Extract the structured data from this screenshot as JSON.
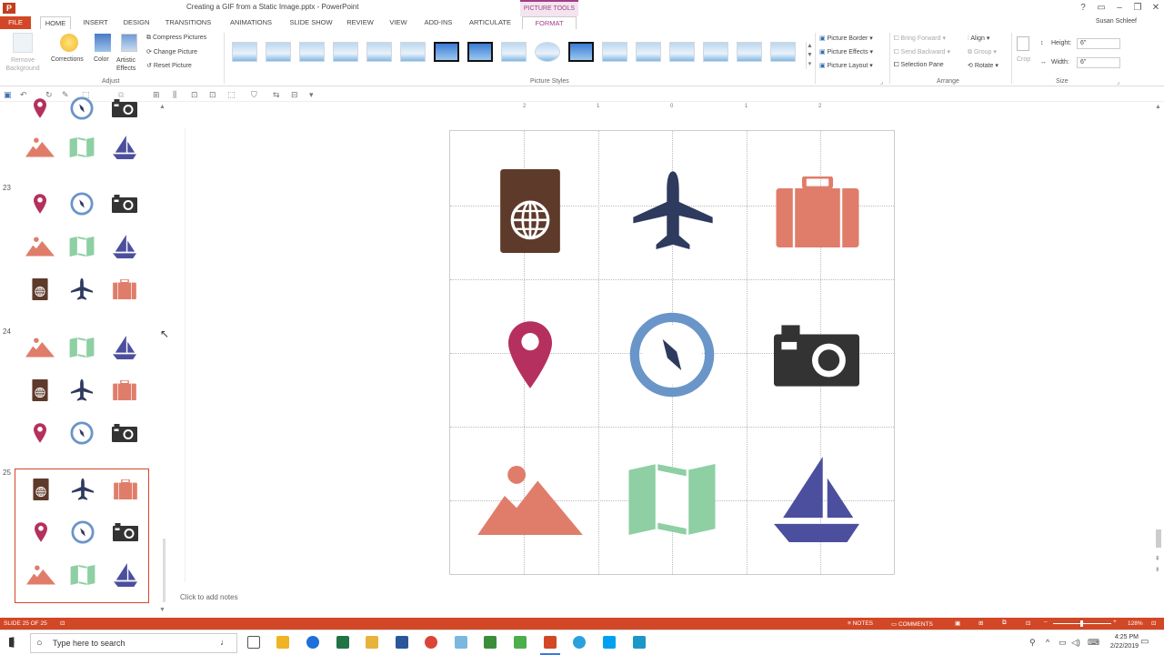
{
  "window": {
    "title": "Creating a GIF from a Static Image.pptx - PowerPoint",
    "contextual_tab_group": "PICTURE TOOLS",
    "user": "Susan Schleef",
    "app_icon_letter": "P"
  },
  "tabs": [
    "FILE",
    "HOME",
    "INSERT",
    "DESIGN",
    "TRANSITIONS",
    "ANIMATIONS",
    "SLIDE SHOW",
    "REVIEW",
    "VIEW",
    "ADD-INS",
    "ARTICULATE",
    "FORMAT"
  ],
  "ribbon": {
    "remove_background": "Remove Background",
    "corrections": "Corrections",
    "color": "Color",
    "artistic_effects": "Artistic Effects",
    "compress_pictures": "Compress Pictures",
    "change_picture": "Change Picture",
    "reset_picture": "Reset Picture",
    "adjust_group": "Adjust",
    "picture_styles_group": "Picture Styles",
    "picture_border": "Picture Border",
    "picture_effects": "Picture Effects",
    "picture_layout": "Picture Layout",
    "bring_forward": "Bring Forward",
    "send_backward": "Send Backward",
    "selection_pane": "Selection Pane",
    "align": "Align",
    "group": "Group",
    "rotate": "Rotate",
    "crop": "Crop",
    "arrange_group": "Arrange",
    "height_label": "Height:",
    "height_value": "6\"",
    "width_label": "Width:",
    "width_value": "6\"",
    "size_group": "Size"
  },
  "thumbnails": {
    "slide_numbers": [
      "23",
      "24",
      "25"
    ],
    "selected": "25"
  },
  "ruler": [
    "2",
    "1",
    "0",
    "1",
    "2"
  ],
  "notes_placeholder": "Click to add notes",
  "status": {
    "slide_info": "SLIDE 25 OF 25",
    "notes": "NOTES",
    "comments": "COMMENTS",
    "zoom": "128%"
  },
  "taskbar": {
    "search_placeholder": "Type here to search",
    "time": "4:25 PM",
    "date": "2/22/2019"
  },
  "colors": {
    "accent": "#d24726",
    "format_tab": "#a33d8a",
    "passport": "#5e3a2b",
    "plane": "#2e3a5e",
    "suitcase": "#e07d6a",
    "pin": "#b5305e",
    "compass": "#6a95c8",
    "camera": "#333333",
    "mountain": "#e07d6a",
    "map": "#8ecfa3",
    "sailboat": "#4c4f9e"
  }
}
